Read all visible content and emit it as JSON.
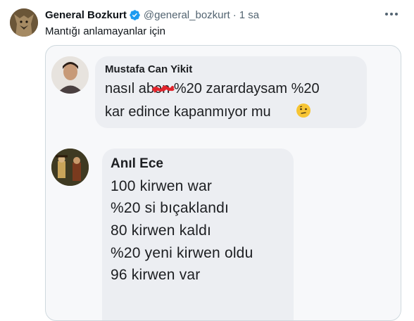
{
  "tweet": {
    "author_name": "General Bozkurt",
    "handle": "@general_bozkurt",
    "separator": "·",
    "time": "1 sa",
    "text": "Mantığı anlamayanlar için",
    "verified_icon": "verified-badge-icon",
    "more_icon": "more-options-icon"
  },
  "media": {
    "comment1": {
      "author": "Mustafa Can Yikit",
      "line1_start": "nasıl a",
      "line1_end": "ben %20 zarardaysam %20",
      "line2": "kar edince kapanmıyor mu",
      "emoji": "thinking-face-emoji"
    },
    "comment2": {
      "author": "Anıl Ece",
      "lines": [
        "100 kirwen war",
        "%20 si bıçaklandı",
        "80 kirwen kaldı",
        "%20 yeni kirwen oldu",
        "96 kirwen var"
      ]
    }
  },
  "colors": {
    "verified": "#1d9bf0",
    "text": "#0f1419",
    "muted": "#536471",
    "bubble": "#eceef2",
    "scribble": "#e0242c"
  }
}
